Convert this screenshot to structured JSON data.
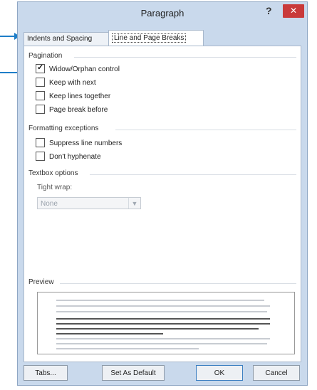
{
  "window": {
    "title": "Paragraph",
    "help": "?",
    "close": "✕"
  },
  "tabs": [
    {
      "label": "Indents and Spacing",
      "selected": false
    },
    {
      "label": "Line and Page Breaks",
      "selected": true
    }
  ],
  "pagination": {
    "heading": "Pagination",
    "items": [
      {
        "label": "Widow/Orphan control",
        "checked": true
      },
      {
        "label": "Keep with next",
        "checked": false
      },
      {
        "label": "Keep lines together",
        "checked": false
      },
      {
        "label": "Page break before",
        "checked": false
      }
    ]
  },
  "formatting": {
    "heading": "Formatting exceptions",
    "items": [
      {
        "label": "Suppress line numbers",
        "checked": false
      },
      {
        "label": "Don't hyphenate",
        "checked": false
      }
    ]
  },
  "textbox": {
    "heading": "Textbox options",
    "tight_wrap_label": "Tight wrap:",
    "tight_wrap_value": "None"
  },
  "preview": {
    "heading": "Preview"
  },
  "buttons": {
    "tabs": "Tabs...",
    "set_default": "Set As Default",
    "ok": "OK",
    "cancel": "Cancel"
  },
  "colors": {
    "arrow": "#1e7ec8",
    "close_button": "#c93a3a",
    "dialog_frame": "#c9d9ec"
  }
}
